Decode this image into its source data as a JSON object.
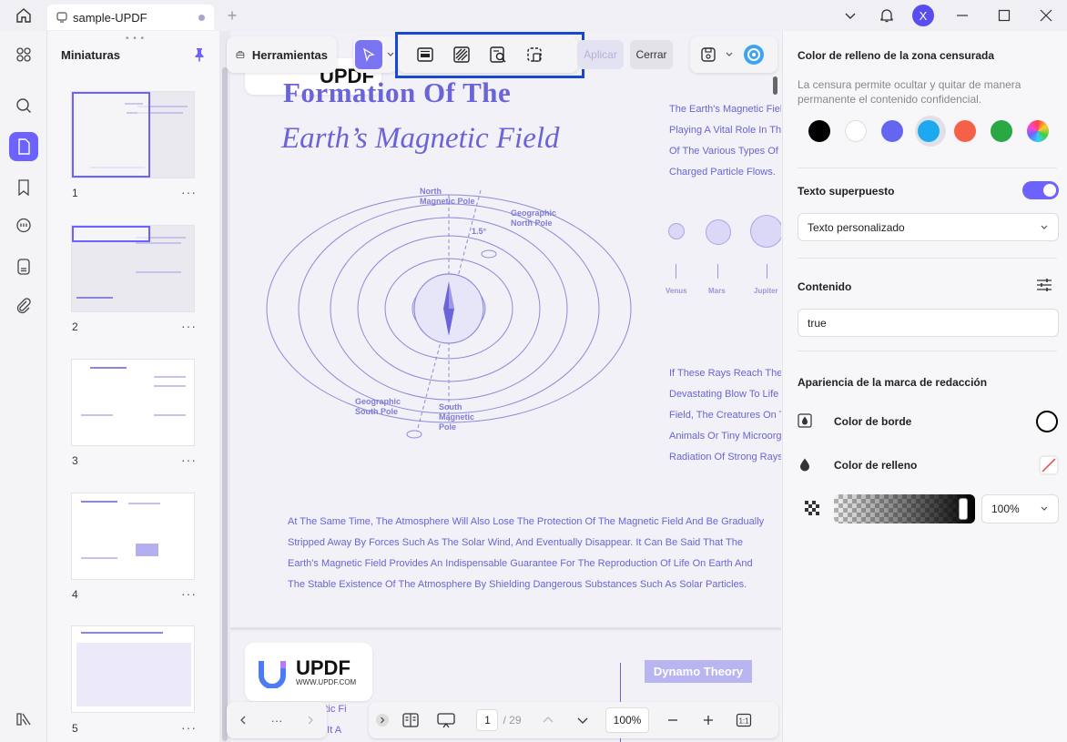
{
  "titlebar": {
    "tab_title": "sample-UPDF",
    "avatar_letter": "X"
  },
  "thumbnails": {
    "heading": "Miniaturas",
    "more_label": "···",
    "pages": [
      "1",
      "2",
      "3",
      "4",
      "5"
    ]
  },
  "toolbar": {
    "tools_label": "Herramientas",
    "apply_label": "Aplicar",
    "close_label": "Cerrar"
  },
  "document": {
    "logo_word": "UPDF",
    "logo_url": "WWW.UPDF.COM",
    "title_line1": "Formation Of The",
    "title_line2": "Earth’s Magnetic Field",
    "right_para1": [
      "The Earth's Magnetic Field",
      "Playing A Vital Role In The",
      "Of The Various Types Of",
      "Charged Particle Flows."
    ],
    "planets": [
      "Venus",
      "Mars",
      "Jupiter"
    ],
    "right_para2": [
      "If These Rays Reach The",
      "Devastating Blow To Life",
      "Field, The Creatures On T",
      "Animals Or Tiny Microorg",
      "Radiation Of Strong Rays"
    ],
    "diagram": {
      "north_magnetic_pole": "North\nMagnetic Pole",
      "geographic_north_pole": "Geographic\nNorth Pole",
      "angle": "1.5°",
      "geographic_south_pole": "Geographic\nSouth Pole",
      "south_magnetic_pole": "South\nMagnetic\nPole"
    },
    "body_lines": [
      "At The Same Time, The Atmosphere Will Also Lose The Protection Of The Magnetic Field And Be Gradually",
      "Stripped Away By Forces Such As The Solar Wind, And Eventually Disappear. It Can Be Said That The",
      "Earth's Magnetic Field Provides An Indispensable Guarantee For The Reproduction Of Life On Earth And",
      "The Stable Existence Of The Atmosphere By Shielding Dangerous Substances Such As Solar Particles."
    ],
    "page2_logo_word": "UPDF",
    "page2_logo_url": "WWW.UPDF.COM",
    "page2_heading": "Dynamo Theory",
    "page2_frag1": "gnetic Fi",
    "page2_frag2": "sts. It A"
  },
  "bottombar": {
    "more_label": "···",
    "current_page": "1",
    "total_pages": "/ 29",
    "zoom": "100%"
  },
  "panel": {
    "fill_color_title": "Color de relleno de la zona censurada",
    "fill_color_desc": "La censura permite ocultar y quitar de manera permanente el contenido confidencial.",
    "swatches": [
      "#000000",
      "#ffffff",
      "#6466f1",
      "#1ea8f0",
      "#f46148",
      "#2aa844",
      "rainbow"
    ],
    "selected_swatch": "#1ea8f0",
    "overlay_title": "Texto superpuesto",
    "overlay_enabled": true,
    "overlay_option": "Texto personalizado",
    "content_title": "Contenido",
    "content_value": "true",
    "appearance_title": "Apariencia de la marca de redacción",
    "border_color_label": "Color de borde",
    "fill_color_label": "Color de relleno",
    "opacity_value": "100%"
  },
  "colors": {
    "accent": "#6c63ff",
    "doc_text": "#6a64d8",
    "highlight_box": "#1848d0"
  }
}
